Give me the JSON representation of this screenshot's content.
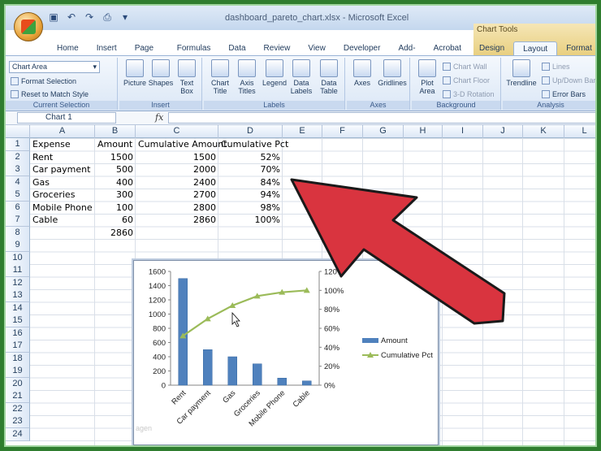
{
  "window": {
    "title": "dashboard_pareto_chart.xlsx - Microsoft Excel",
    "context_tab_group": "Chart Tools"
  },
  "tabs": [
    "Home",
    "Insert",
    "Page Layout",
    "Formulas",
    "Data",
    "Review",
    "View",
    "Developer",
    "Add-Ins",
    "Acrobat",
    "Design",
    "Layout",
    "Format"
  ],
  "active_tab": "Layout",
  "ribbon": {
    "current_selection": {
      "dropdown": "Chart Area",
      "format_selection": "Format Selection",
      "reset": "Reset to Match Style",
      "label": "Current Selection"
    },
    "insert": {
      "picture": "Picture",
      "shapes": "Shapes",
      "text_box_1": "Text",
      "text_box_2": "Box",
      "label": "Insert"
    },
    "labels": {
      "chart_title_1": "Chart",
      "chart_title_2": "Title",
      "axis_titles_1": "Axis",
      "axis_titles_2": "Titles",
      "legend": "Legend",
      "data_labels_1": "Data",
      "data_labels_2": "Labels",
      "data_table_1": "Data",
      "data_table_2": "Table",
      "label": "Labels"
    },
    "axes": {
      "axes": "Axes",
      "gridlines": "Gridlines",
      "label": "Axes"
    },
    "background": {
      "plot_area_1": "Plot",
      "plot_area_2": "Area",
      "chart_wall": "Chart Wall",
      "chart_floor": "Chart Floor",
      "rotation": "3-D Rotation",
      "label": "Background"
    },
    "analysis": {
      "trendline": "Trendline",
      "lines": "Lines",
      "updown": "Up/Down Bar",
      "error_bars": "Error Bars",
      "label": "Analysis"
    }
  },
  "formula_bar": {
    "name_box": "Chart 1",
    "fx": "fx",
    "content": ""
  },
  "columns": [
    "A",
    "B",
    "C",
    "D",
    "E",
    "F",
    "G",
    "H",
    "I",
    "J",
    "K",
    "L"
  ],
  "rows": [
    "1",
    "2",
    "3",
    "4",
    "5",
    "6",
    "7",
    "8",
    "9",
    "10",
    "11",
    "12",
    "13",
    "14",
    "15",
    "16",
    "17",
    "18",
    "19",
    "20",
    "21",
    "22",
    "23",
    "24"
  ],
  "table": {
    "headers": [
      "Expense",
      "Amount",
      "Cumulative Amount",
      "Cumulative Pct"
    ],
    "rows": [
      [
        "Rent",
        "1500",
        "1500",
        "52%"
      ],
      [
        "Car payment",
        "500",
        "2000",
        "70%"
      ],
      [
        "Gas",
        "400",
        "2400",
        "84%"
      ],
      [
        "Groceries",
        "300",
        "2700",
        "94%"
      ],
      [
        "Mobile Phone",
        "100",
        "2800",
        "98%"
      ],
      [
        "Cable",
        "60",
        "2860",
        "100%"
      ]
    ],
    "total": "2860"
  },
  "chart_data": {
    "type": "bar",
    "categories": [
      "Rent",
      "Car payment",
      "Gas",
      "Groceries",
      "Mobile Phone",
      "Cable"
    ],
    "series": [
      {
        "name": "Amount",
        "kind": "bar",
        "axis": "left",
        "values": [
          1500,
          500,
          400,
          300,
          100,
          60
        ],
        "color": "#4f81bd"
      },
      {
        "name": "Cumulative Pct",
        "kind": "line",
        "axis": "right",
        "values": [
          52,
          70,
          84,
          94,
          98,
          100
        ],
        "color": "#9bbb59"
      }
    ],
    "y_left": {
      "min": 0,
      "max": 1600,
      "step": 200,
      "ticks": [
        "0",
        "200",
        "400",
        "600",
        "800",
        "1000",
        "1200",
        "1400",
        "1600"
      ]
    },
    "y_right": {
      "min": 0,
      "max": 120,
      "step": 20,
      "ticks": [
        "0%",
        "20%",
        "40%",
        "60%",
        "80%",
        "100%",
        "120%"
      ]
    },
    "legend": [
      "Amount",
      "Cumulative Pct"
    ],
    "legend_position": "right",
    "watermark_text": "agen"
  },
  "colors": {
    "bar": "#4f81bd",
    "line": "#9bbb59",
    "arrow": "#d9343f",
    "frame": "#2f7d2f"
  }
}
